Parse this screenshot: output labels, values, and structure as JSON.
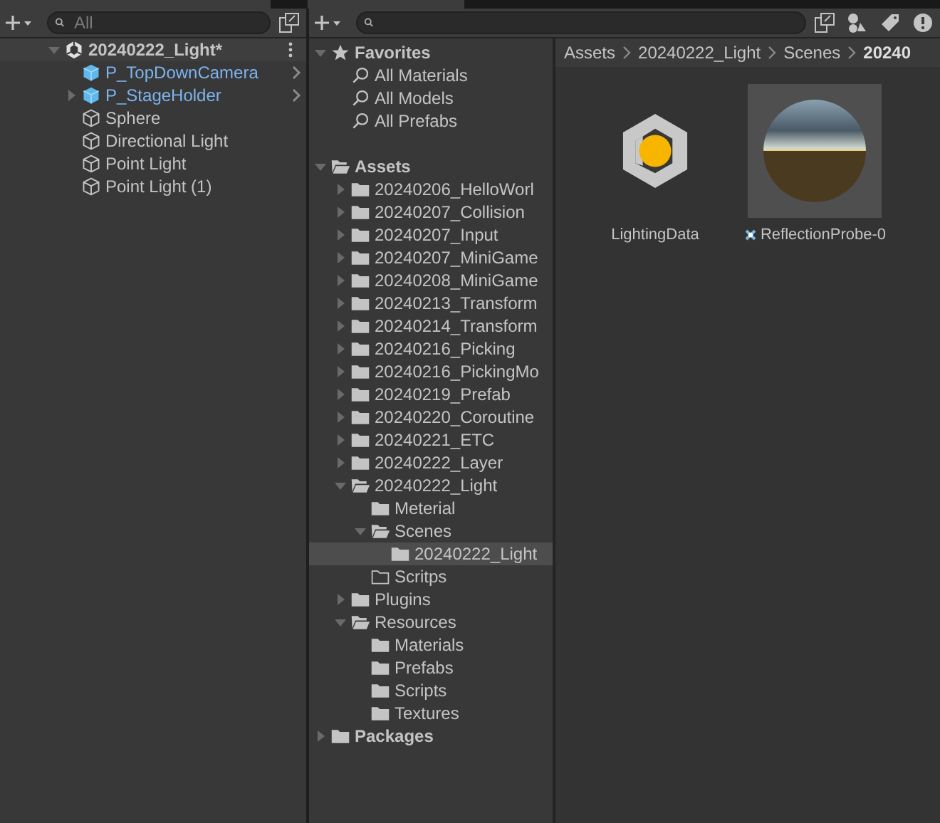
{
  "hierarchy": {
    "search": {
      "placeholder": "All"
    },
    "scene": {
      "title": "20240222_Light*",
      "expanded": true,
      "children": [
        {
          "label": "P_TopDownCamera",
          "kind": "prefab"
        },
        {
          "label": "P_StageHolder",
          "kind": "prefab",
          "expanded": false
        },
        {
          "label": "Sphere",
          "kind": "object"
        },
        {
          "label": "Directional Light",
          "kind": "object"
        },
        {
          "label": "Point Light",
          "kind": "object"
        },
        {
          "label": "Point Light (1)",
          "kind": "object"
        }
      ]
    }
  },
  "project": {
    "tree": [
      {
        "label": "Favorites",
        "kind": "favorites",
        "expanded": true,
        "selected": false,
        "children": [
          {
            "label": "All Materials",
            "kind": "search",
            "selected": false
          },
          {
            "label": "All Models",
            "kind": "search",
            "selected": false
          },
          {
            "label": "All Prefabs",
            "kind": "search",
            "selected": false
          }
        ]
      },
      {
        "label": "Assets",
        "kind": "root",
        "expanded": true,
        "selected": false,
        "children": [
          {
            "label": "20240206_HelloWorl",
            "kind": "folder",
            "expanded": false,
            "selected": false
          },
          {
            "label": "20240207_Collision",
            "kind": "folder",
            "expanded": false,
            "selected": false
          },
          {
            "label": "20240207_Input",
            "kind": "folder",
            "expanded": false,
            "selected": false
          },
          {
            "label": "20240207_MiniGame",
            "kind": "folder",
            "expanded": false,
            "selected": false
          },
          {
            "label": "20240208_MiniGame",
            "kind": "folder",
            "expanded": false,
            "selected": false
          },
          {
            "label": "20240213_Transform",
            "kind": "folder",
            "expanded": false,
            "selected": false
          },
          {
            "label": "20240214_Transform",
            "kind": "folder",
            "expanded": false,
            "selected": false
          },
          {
            "label": "20240216_Picking",
            "kind": "folder",
            "expanded": false,
            "selected": false
          },
          {
            "label": "20240216_PickingMo",
            "kind": "folder",
            "expanded": false,
            "selected": false
          },
          {
            "label": "20240219_Prefab",
            "kind": "folder",
            "expanded": false,
            "selected": false
          },
          {
            "label": "20240220_Coroutine",
            "kind": "folder",
            "expanded": false,
            "selected": false
          },
          {
            "label": "20240221_ETC",
            "kind": "folder",
            "expanded": false,
            "selected": false
          },
          {
            "label": "20240222_Layer",
            "kind": "folder",
            "expanded": false,
            "selected": false
          },
          {
            "label": "20240222_Light",
            "kind": "folder",
            "expanded": true,
            "selected": false,
            "children": [
              {
                "label": "Meterial",
                "kind": "folder",
                "selected": false
              },
              {
                "label": "Scenes",
                "kind": "folder",
                "expanded": true,
                "selected": false,
                "children": [
                  {
                    "label": "20240222_Light",
                    "kind": "folder",
                    "selected": true
                  }
                ]
              },
              {
                "label": "Scritps",
                "kind": "empty-folder",
                "selected": false
              }
            ]
          },
          {
            "label": "Plugins",
            "kind": "folder",
            "expanded": false,
            "selected": false
          },
          {
            "label": "Resources",
            "kind": "folder",
            "expanded": true,
            "selected": false,
            "children": [
              {
                "label": "Materials",
                "kind": "folder",
                "selected": false
              },
              {
                "label": "Prefabs",
                "kind": "folder",
                "selected": false
              },
              {
                "label": "Scripts",
                "kind": "folder",
                "selected": false
              },
              {
                "label": "Textures",
                "kind": "folder",
                "selected": false
              }
            ]
          }
        ]
      },
      {
        "label": "Packages",
        "kind": "root",
        "expanded": false,
        "selected": false
      }
    ],
    "breadcrumb": [
      "Assets",
      "20240222_Light",
      "Scenes",
      "20240"
    ],
    "assets": [
      {
        "name": "LightingData",
        "kind": "lighting-data"
      },
      {
        "name": "ReflectionProbe-0",
        "kind": "reflection-probe"
      }
    ]
  }
}
